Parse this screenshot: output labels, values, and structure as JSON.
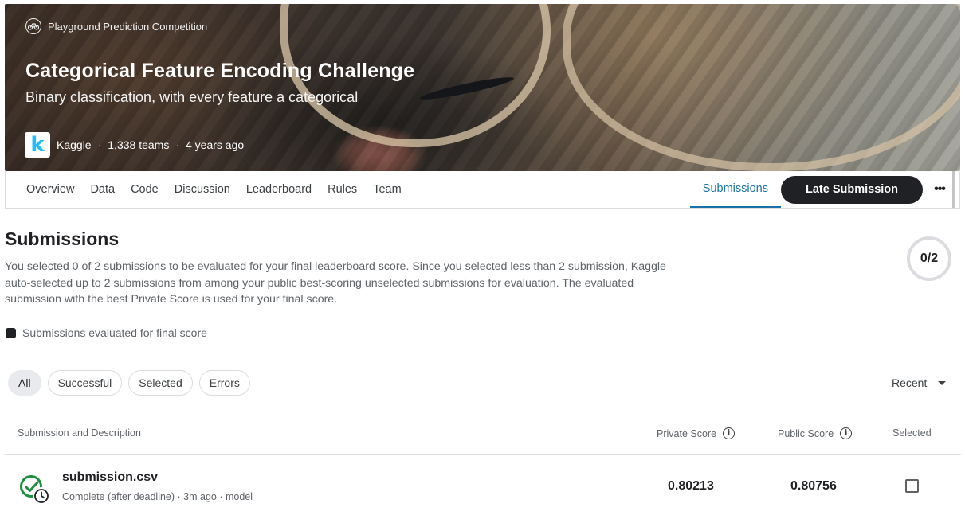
{
  "banner": {
    "competition_type": "Playground Prediction Competition",
    "title": "Categorical Feature Encoding Challenge",
    "subtitle": "Binary classification, with every feature a categorical",
    "host_logo_letter": "k",
    "host": "Kaggle",
    "teams": "1,338 teams",
    "age": "4 years ago"
  },
  "nav": {
    "tabs": [
      "Overview",
      "Data",
      "Code",
      "Discussion",
      "Leaderboard",
      "Rules",
      "Team"
    ],
    "active_tab": "Submissions",
    "late_submission": "Late Submission",
    "more": "•••"
  },
  "submissions": {
    "title": "Submissions",
    "description": "You selected 0 of 2 submissions to be evaluated for your final leaderboard score. Since you selected less than 2 submission, Kaggle auto-selected up to 2 submissions from among your public best-scoring unselected submissions for evaluation. The evaluated submission with the best Private Score is used for your final score.",
    "counter": "0/2",
    "legend": "Submissions evaluated for final score",
    "filters": [
      "All",
      "Successful",
      "Selected",
      "Errors"
    ],
    "active_filter": "All",
    "sort": "Recent"
  },
  "table": {
    "headers": {
      "submission": "Submission and Description",
      "private": "Private Score",
      "public": "Public Score",
      "selected": "Selected"
    },
    "rows": [
      {
        "file": "submission.csv",
        "meta": "Complete (after deadline) · 3m ago · model",
        "private_score": "0.80213",
        "public_score": "0.80756",
        "selected": false
      }
    ]
  },
  "colors": {
    "accent": "#1a73a8",
    "success": "#1e8e3e",
    "dark": "#202124"
  }
}
